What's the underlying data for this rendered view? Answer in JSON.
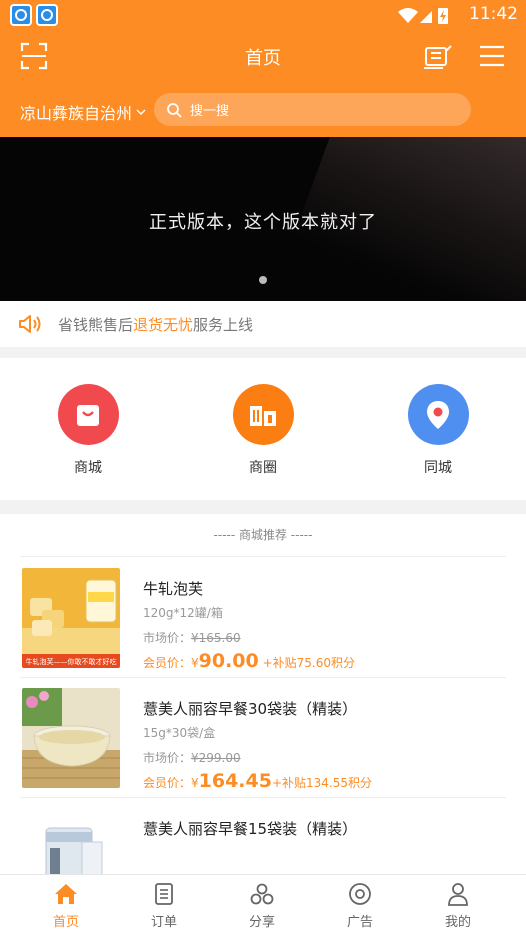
{
  "status_bar": {
    "time": "11:42"
  },
  "header": {
    "title": "首页",
    "city": "凉山彝族自治州",
    "search_placeholder": "搜一搜"
  },
  "banner": {
    "text": "正式版本，这个版本就对了"
  },
  "notice": {
    "prefix": "省钱熊售后",
    "highlight": "退货无忧",
    "suffix": "服务上线"
  },
  "categories": [
    {
      "label": "商城",
      "color": "#f04a4e",
      "icon": "shopping-bag-icon"
    },
    {
      "label": "商圈",
      "color": "#fb7e12",
      "icon": "buildings-icon"
    },
    {
      "label": "同城",
      "color": "#4f8ff0",
      "icon": "location-pin-icon"
    }
  ],
  "section_title": "----- 商城推荐 -----",
  "products": [
    {
      "name": "牛轧泡芙",
      "spec": "120g*12罐/箱",
      "market_label": "市场价：",
      "market_price": "¥165.60",
      "member_label": "会员价：¥",
      "member_price": "90.00",
      "subsidy": "+补贴75.60积分",
      "thumb_caption": "牛轧泡芙——你敢不敢才好吃"
    },
    {
      "name": "薏美人丽容早餐30袋装（精装）",
      "spec": "15g*30袋/盒",
      "market_label": "市场价：",
      "market_price": "¥299.00",
      "member_label": "会员价：¥",
      "member_price": "164.45",
      "subsidy": "+补贴134.55积分"
    },
    {
      "name": "薏美人丽容早餐15袋装（精装）"
    }
  ],
  "tabs": [
    {
      "label": "首页",
      "icon": "home-icon",
      "active": true
    },
    {
      "label": "订单",
      "icon": "order-icon"
    },
    {
      "label": "分享",
      "icon": "share-icon"
    },
    {
      "label": "广告",
      "icon": "ad-icon"
    },
    {
      "label": "我的",
      "icon": "profile-icon"
    }
  ],
  "colors": {
    "accent": "#fd8c24"
  }
}
